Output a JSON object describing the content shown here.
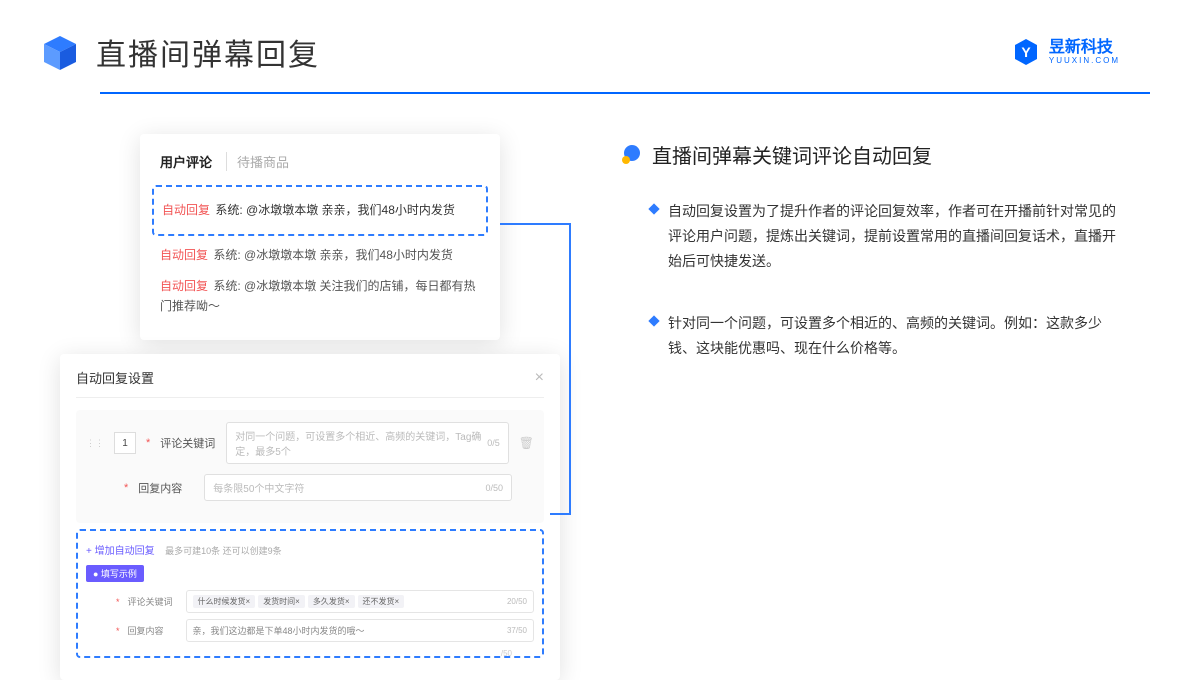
{
  "header": {
    "title": "直播间弹幕回复",
    "brand": "昱新科技",
    "brand_sub": "YUUXIN.COM"
  },
  "top_card": {
    "tab_active": "用户评论",
    "tab_inactive": "待播商品",
    "rows": [
      {
        "tag": "自动回复",
        "text": "系统: @冰墩墩本墩 亲亲，我们48小时内发货"
      },
      {
        "tag": "自动回复",
        "text": "系统: @冰墩墩本墩 亲亲，我们48小时内发货"
      },
      {
        "tag": "自动回复",
        "text": "系统: @冰墩墩本墩 关注我们的店铺，每日都有热门推荐呦～"
      }
    ]
  },
  "bot_card": {
    "title": "自动回复设置",
    "idx": "1",
    "kw_label": "评论关键词",
    "kw_placeholder": "对同一个问题，可设置多个相近、高频的关键词，Tag确定，最多5个",
    "kw_count": "0/5",
    "reply_label": "回复内容",
    "reply_placeholder": "每条限50个中文字符",
    "reply_count": "0/50",
    "add_link": "+ 增加自动回复",
    "add_note": "最多可建10条 还可以创建9条",
    "ex_badge": "● 填写示例",
    "ex_kw_label": "评论关键词",
    "ex_tags": [
      "什么时候发货×",
      "发货时间×",
      "多久发货×",
      "还不发货×"
    ],
    "ex_kw_count": "20/50",
    "ex_reply_label": "回复内容",
    "ex_reply_text": "亲，我们这边都是下单48小时内发货的哦～",
    "ex_reply_count": "37/50",
    "lone_count": "/50"
  },
  "right": {
    "title": "直播间弹幕关键词评论自动回复",
    "b1": "自动回复设置为了提升作者的评论回复效率，作者可在开播前针对常见的评论用户问题，提炼出关键词，提前设置常用的直播间回复话术，直播开始后可快捷发送。",
    "b2": "针对同一个问题，可设置多个相近的、高频的关键词。例如：这款多少钱、这块能优惠吗、现在什么价格等。"
  }
}
